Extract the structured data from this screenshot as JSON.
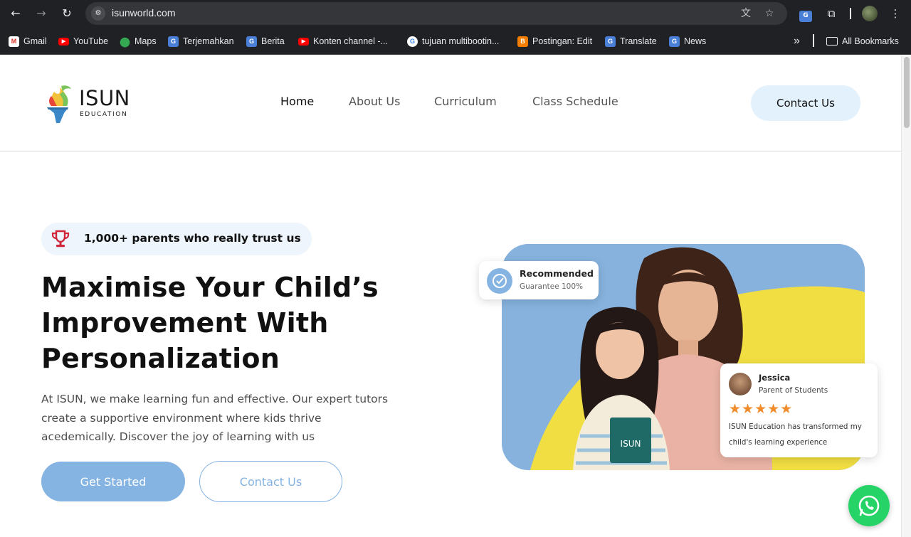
{
  "browser": {
    "url": "isunworld.com",
    "bookmarks": [
      {
        "label": "Gmail",
        "icon": "gmail-icon"
      },
      {
        "label": "YouTube",
        "icon": "youtube-icon"
      },
      {
        "label": "Maps",
        "icon": "maps-icon"
      },
      {
        "label": "Terjemahkan",
        "icon": "translate-icon"
      },
      {
        "label": "Berita",
        "icon": "news-icon"
      },
      {
        "label": "Konten channel -...",
        "icon": "youtube-icon"
      },
      {
        "label": "tujuan multibootin...",
        "icon": "google-icon"
      },
      {
        "label": "Postingan: Edit",
        "icon": "blogger-icon"
      },
      {
        "label": "Translate",
        "icon": "translate-icon"
      },
      {
        "label": "News",
        "icon": "news-icon"
      }
    ],
    "more_label": "»",
    "all_bookmarks": "All Bookmarks"
  },
  "site": {
    "logo_word": "ISUN",
    "logo_sub": "EDUCATION",
    "nav": {
      "home": "Home",
      "about": "About Us",
      "curriculum": "Curriculum",
      "schedule": "Class Schedule"
    },
    "contact_button": "Contact Us"
  },
  "hero": {
    "trust_badge": "1,000+ parents who really trust us",
    "headline_1": "Maximise Your Child’s",
    "headline_2": "Improvement With",
    "headline_3": "Personalization",
    "lead": "At ISUN, we make learning fun and effective. Our expert tutors create a supportive environment where kids thrive acedemically. Discover the joy of learning with us",
    "cta_primary": "Get Started",
    "cta_secondary": "Contact Us"
  },
  "recommended_card": {
    "title": "Recommended",
    "subtitle": "Guarantee 100%"
  },
  "review_card": {
    "name": "Jessica",
    "role": "Parent of Students",
    "rating": 5,
    "stars": "★★★★★",
    "text": "ISUN Education has transformed my child's learning experience"
  },
  "book_label": "ISUN",
  "colors": {
    "accent_blue": "#85b4e3",
    "accent_light": "#e3f1fd",
    "hero_yellow": "#f1de43",
    "star_orange": "#f08c2b",
    "whatsapp_green": "#25d366",
    "trophy_red": "#d0263a"
  }
}
